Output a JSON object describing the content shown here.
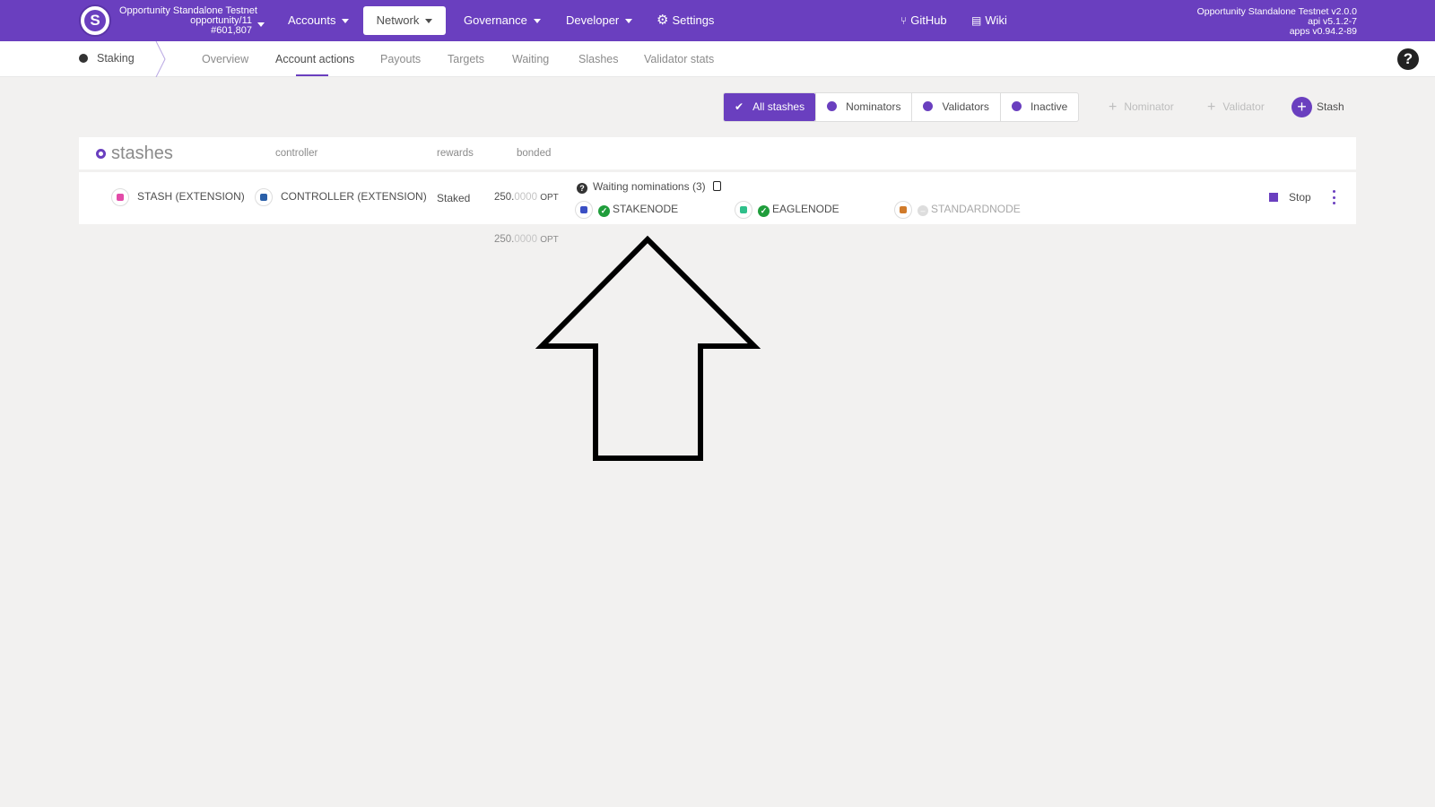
{
  "topbar": {
    "chain_name": "Opportunity Standalone Testnet",
    "account": "opportunity/11",
    "block": "#601,807",
    "nav": {
      "accounts": "Accounts",
      "network": "Network",
      "governance": "Governance",
      "developer": "Developer",
      "settings": "Settings",
      "github": "GitHub",
      "wiki": "Wiki"
    },
    "version": {
      "line1": "Opportunity Standalone Testnet v2.0.0",
      "line2": "api v5.1.2-7",
      "line3": "apps v0.94.2-89"
    }
  },
  "subnav": {
    "title": "Staking",
    "tabs": [
      "Overview",
      "Account actions",
      "Payouts",
      "Targets",
      "Waiting",
      "Slashes",
      "Validator stats"
    ],
    "active_tab": "Account actions"
  },
  "filters": {
    "all": "All stashes",
    "nominators": "Nominators",
    "validators": "Validators",
    "inactive": "Inactive"
  },
  "actions": {
    "nominator": "Nominator",
    "validator": "Validator",
    "stash": "Stash"
  },
  "table": {
    "title": "stashes",
    "headers": {
      "controller": "controller",
      "rewards": "rewards",
      "bonded": "bonded"
    },
    "row": {
      "stash": "STASH (EXTENSION)",
      "controller": "CONTROLLER (EXTENSION)",
      "rewards": "Staked",
      "bonded_int": "250.",
      "bonded_dec": "0000",
      "bonded_unit": "OPT",
      "nominations_label": "Waiting nominations (3)",
      "nominees": [
        {
          "name": "STAKENODE",
          "status": "ok"
        },
        {
          "name": "EAGLENODE",
          "status": "ok"
        },
        {
          "name": "STANDARDNODE",
          "status": "inactive"
        }
      ],
      "stop": "Stop"
    },
    "total_int": "250.",
    "total_dec": "0000",
    "total_unit": "OPT"
  },
  "colors": {
    "accent": "#6a3fbf",
    "ok": "#1f9d3b",
    "background": "#f2f1f0"
  },
  "icons": [
    "logo-icon",
    "caret-down-icon",
    "gear-icon",
    "github-icon",
    "wiki-icon",
    "help-icon",
    "check-icon",
    "plus-icon",
    "question-icon",
    "lock-icon",
    "stop-icon",
    "kebab-icon",
    "arrow-up-icon"
  ]
}
